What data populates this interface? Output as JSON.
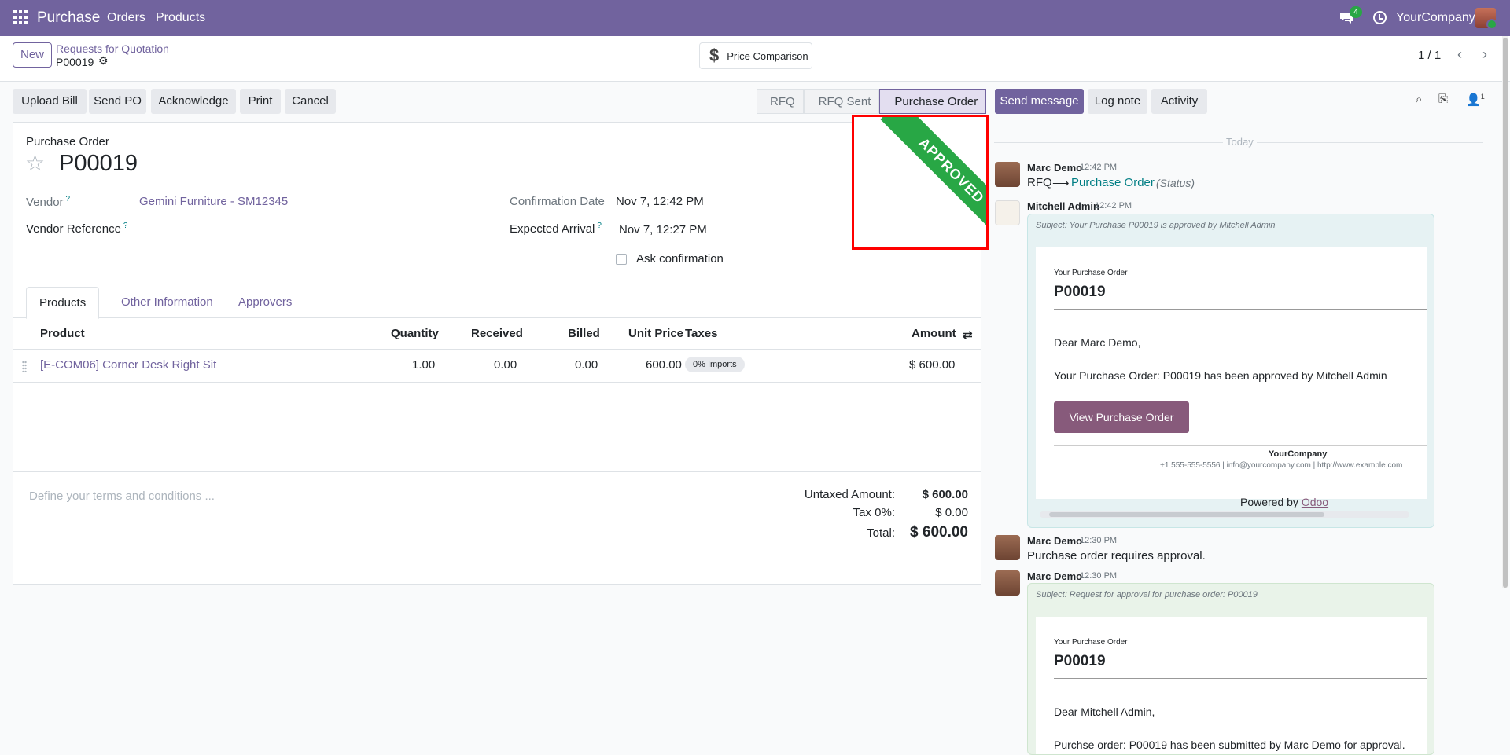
{
  "navbar": {
    "app": "Purchase",
    "menu": [
      "Orders",
      "Products"
    ],
    "chat_count": "4",
    "company": "YourCompany",
    "bg_color": "#71639e"
  },
  "control_panel": {
    "new_label": "New",
    "breadcrumb_parent": "Requests for Quotation",
    "breadcrumb_current": "P00019",
    "price_comparison": "Price Comparison",
    "pager": "1 / 1"
  },
  "actions": [
    "Upload Bill",
    "Send PO",
    "Acknowledge",
    "Print",
    "Cancel"
  ],
  "statusbar": {
    "stages": [
      "RFQ",
      "RFQ Sent",
      "Purchase Order"
    ],
    "active": "Purchase Order"
  },
  "form": {
    "type_label": "Purchase Order",
    "name": "P00019",
    "ribbon": "APPROVED",
    "fields": {
      "vendor_label": "Vendor",
      "vendor_value": "Gemini Furniture - SM12345",
      "vendor_ref_label": "Vendor Reference",
      "confirmation_label": "Confirmation Date",
      "confirmation_value": "Nov 7, 12:42 PM",
      "expected_label": "Expected Arrival",
      "expected_value": "Nov 7, 12:27 PM",
      "ask_confirmation": "Ask confirmation",
      "help_mark": "?"
    },
    "tabs": [
      "Products",
      "Other Information",
      "Approvers"
    ],
    "table": {
      "headers": [
        "Product",
        "Quantity",
        "Received",
        "Billed",
        "Unit Price",
        "Taxes",
        "Amount"
      ],
      "rows": [
        {
          "product": "[E-COM06] Corner Desk Right Sit",
          "quantity": "1.00",
          "received": "0.00",
          "billed": "0.00",
          "unit_price": "600.00",
          "taxes": "0% Imports",
          "amount": "$ 600.00"
        }
      ]
    },
    "terms_placeholder": "Define your terms and conditions ...",
    "totals": {
      "untaxed_label": "Untaxed Amount:",
      "untaxed_value": "$ 600.00",
      "tax_label": "Tax 0%:",
      "tax_value": "$ 0.00",
      "total_label": "Total:",
      "total_value": "$ 600.00"
    }
  },
  "chatter": {
    "buttons": [
      "Send message",
      "Log note",
      "Activity"
    ],
    "followers_count": "1",
    "day": "Today",
    "messages": [
      {
        "author": "Marc Demo",
        "time": "12:42 PM",
        "from": "RFQ",
        "arrow": "⟶",
        "to": "Purchase Order",
        "field": "(Status)"
      },
      {
        "author": "Mitchell Admin",
        "time": "12:42 PM",
        "subject": "Subject: Your Purchase P00019 is approved by Mitchell Admin",
        "mail_label": "Your Purchase Order",
        "mail_title": "P00019",
        "greeting": "Dear Marc Demo,",
        "body": "Your Purchase Order: P00019 has been approved by Mitchell Admin",
        "button": "View Purchase Order",
        "company": "YourCompany",
        "contact": "+1 555-555-5556 | info@yourcompany.com | http://www.example.com",
        "powered_by": "Powered by",
        "powered_link": "Odoo"
      },
      {
        "author": "Marc Demo",
        "time": "12:30 PM",
        "body": "Purchase order requires approval."
      },
      {
        "author": "Marc Demo",
        "time": "12:30 PM",
        "subject": "Subject: Request for approval for purchase order: P00019",
        "mail_label": "Your Purchase Order",
        "mail_title": "P00019",
        "greeting": "Dear Mitchell Admin,",
        "body": "Purchse order: P00019 has been submitted by Marc Demo for approval."
      }
    ]
  }
}
